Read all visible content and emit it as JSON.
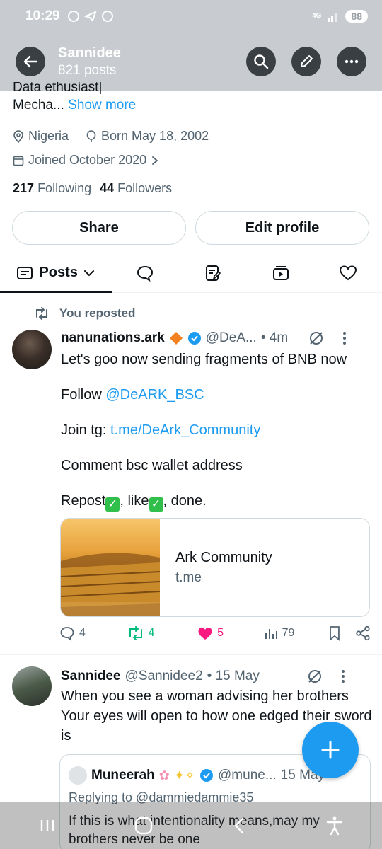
{
  "status_bar": {
    "time": "10:29",
    "network": "4G",
    "battery": "88"
  },
  "header": {
    "name": "Sannidee",
    "posts_count": "821 posts"
  },
  "profile": {
    "bio_line1": "Data ethusiast|",
    "bio_line2": "Mecha...",
    "show_more": "Show more",
    "location": "Nigeria",
    "born": "Born May 18, 2002",
    "joined": "Joined October 2020",
    "following_count": "217",
    "following_label": "Following",
    "followers_count": "44",
    "followers_label": "Followers",
    "share_label": "Share",
    "edit_label": "Edit profile"
  },
  "tabs": {
    "posts_label": "Posts"
  },
  "post1": {
    "repost_label": "You reposted",
    "author": "nanunations.ark",
    "handle": "@DeA...",
    "time": "• 4m",
    "line1": "Let's goo now sending fragments of BNB now",
    "follow_prefix": "Follow ",
    "follow_link": "@DeARK_BSC",
    "join_prefix": "Join tg: ",
    "join_link": "t.me/DeArk_Community",
    "line4": "Comment bsc wallet address",
    "line5_a": "Repost",
    "line5_b": ", like",
    "line5_c": ", done.",
    "card_title": "Ark Community",
    "card_domain": "t.me",
    "replies": "4",
    "reposts": "4",
    "likes": "5",
    "views": "79"
  },
  "post2": {
    "author": "Sannidee",
    "handle": "@Sannidee2",
    "time": "• 15 May",
    "text": "When you see a woman advising her brothers Your eyes will open to how one edged their sword is",
    "quote_author": "Muneerah",
    "quote_handle": "@mune...",
    "quote_time": "15 May",
    "quote_reply": "Replying to @dammiedammie35",
    "quote_text": "If this is what intentionality means,may my brothers never be one"
  },
  "colors": {
    "accent": "#1d9bf0",
    "like": "#f91880",
    "repost": "#00ba7c",
    "verified": "#1d9bf0"
  }
}
